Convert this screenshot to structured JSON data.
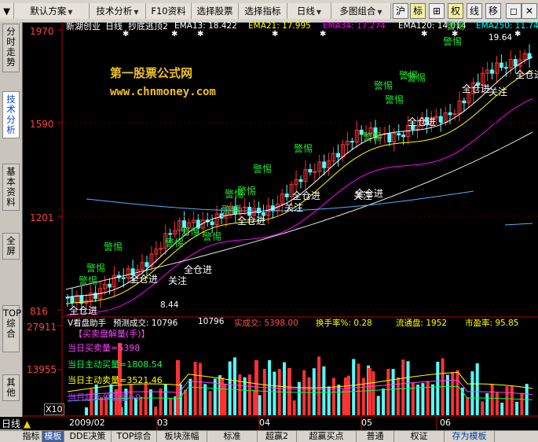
{
  "toolbar": {
    "items": [
      {
        "label": "默认方案",
        "dropdown": true
      },
      {
        "label": "技术分析",
        "dropdown": true
      },
      {
        "label": "F10资料",
        "dropdown": false
      },
      {
        "label": "选择股票",
        "dropdown": false
      },
      {
        "label": "选择指标",
        "dropdown": false
      },
      {
        "label": "日线",
        "dropdown": true
      },
      {
        "label": "多图组合",
        "dropdown": true
      }
    ],
    "icons": [
      {
        "name": "scroll-right-icon",
        "glyph": "沪"
      },
      {
        "name": "mark-button",
        "glyph": "标"
      },
      {
        "name": "crosshair-icon",
        "glyph": "⊞"
      },
      {
        "name": "rights-button",
        "glyph": "权"
      },
      {
        "name": "line-button",
        "glyph": "线"
      },
      {
        "name": "move-button",
        "glyph": "移"
      }
    ],
    "window_icons": [
      "◻",
      "✕"
    ]
  },
  "sidebar": {
    "tabs": [
      {
        "label": "分时走势",
        "active": false
      },
      {
        "label": "技术分析",
        "active": true
      },
      {
        "label": "基本资料",
        "active": false
      },
      {
        "label": "全屏",
        "active": false
      },
      {
        "label": "TOP综合",
        "active": false
      },
      {
        "label": "其他",
        "active": false
      }
    ]
  },
  "main_chart": {
    "stock_name": "新湖创业",
    "period": "日线",
    "formula_name": "抄底逃顶2",
    "ema": [
      {
        "label": "EMA13: 18.422",
        "color": "#ffffff"
      },
      {
        "label": "EMA21: 17.995",
        "color": "#ffff00"
      },
      {
        "label": "EMA34: 17.274",
        "color": "#ff00ff"
      },
      {
        "label": "EMA120: 14.014",
        "color": "#ffffff"
      },
      {
        "label": "EMA250: 11.74",
        "color": "#00ffff"
      }
    ],
    "price_ticks": [
      "1970",
      "1590",
      "1201",
      "816"
    ],
    "high_label": "19.64",
    "low_label": "8.44",
    "watermark_title": "第一股票公式网",
    "watermark_url": "www.chnmoney.com",
    "signal_alert": "警惕",
    "signal_attention": "关注",
    "signal_buy": "全仓进"
  },
  "volume_chart": {
    "title": "V看盘助手",
    "predict_label": "预测成交: 10796",
    "second_value": "10796",
    "actual_label": "实成交: 5398.00",
    "turnover_label": "换手率%: 0.28",
    "float_label": "流通盘: 1952",
    "pe_label": "市盈率: 95.85",
    "subtitle": "【买卖盘解量(手)】",
    "ticks": [
      "27911",
      "13955"
    ],
    "multiplier": "X10",
    "lines": [
      "当日买卖量=5398",
      "当日主动买量=1808.54",
      "当日主动卖量=3521.46"
    ],
    "overlay_text": "当日超大单买量=0"
  },
  "time_axis": {
    "labels": [
      "2009/02",
      "03",
      "04",
      "05",
      "06"
    ]
  },
  "bottom_tabs": {
    "period_label": "日线",
    "tabs": [
      {
        "label": "指标",
        "active": false
      },
      {
        "label": "模板",
        "active": true
      },
      {
        "label": "DDE决策",
        "active": false
      },
      {
        "label": "TOP综合",
        "active": false
      },
      {
        "label": "板块涨幅",
        "active": false
      },
      {
        "label": "标准",
        "active": false
      },
      {
        "label": "超赢2",
        "active": false
      },
      {
        "label": "超赢买点",
        "active": false
      },
      {
        "label": "普通",
        "active": false
      },
      {
        "label": "权证",
        "active": false
      },
      {
        "label": "存为模板",
        "active": false
      }
    ]
  },
  "colors": {
    "up": "#ff3232",
    "down": "#54ffff",
    "alert": "#22dd33",
    "axis": "#c00000",
    "tick_text": "#ff4040"
  }
}
